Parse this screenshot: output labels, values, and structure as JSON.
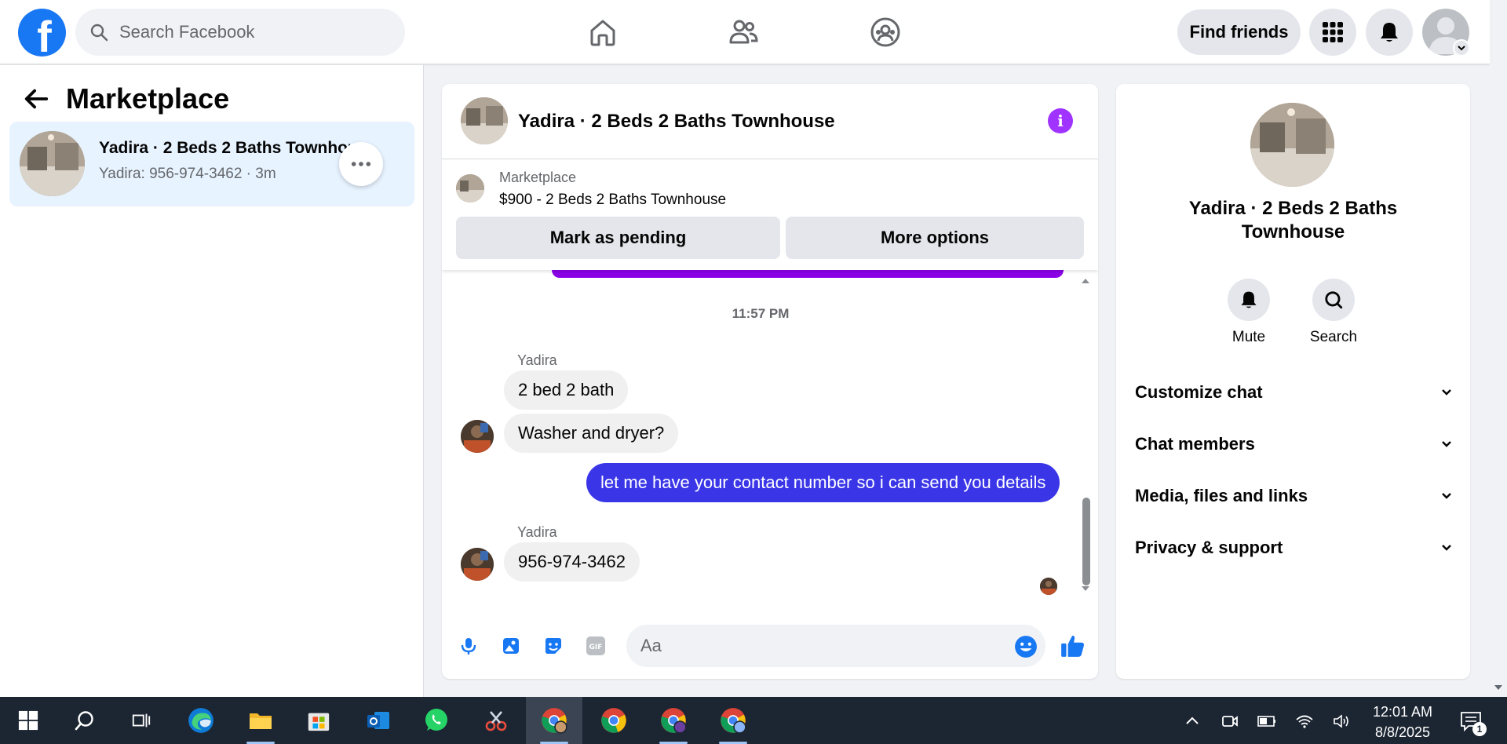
{
  "topbar": {
    "logo_letter": "f",
    "search_placeholder": "Search Facebook",
    "find_friends_label": "Find friends"
  },
  "left_panel": {
    "title": "Marketplace",
    "conversation": {
      "name": "Yadira · 2 Beds 2 Baths Townhouse",
      "preview": "Yadira: 956-974-3462 · 3m"
    }
  },
  "chat": {
    "title": "Yadira · 2 Beds 2 Baths Townhouse",
    "info_icon": "i",
    "listing": {
      "source": "Marketplace",
      "title": "$900 - 2 Beds 2 Baths Townhouse",
      "mark_pending_label": "Mark as pending",
      "more_options_label": "More options"
    },
    "timestamp": "11:57 PM",
    "messages": [
      {
        "sender": "Yadira",
        "text": "2 bed 2 bath"
      },
      {
        "text": "Washer and dryer?"
      },
      {
        "text": "let me have your contact number so i can send you details"
      },
      {
        "sender": "Yadira",
        "text": "956-974-3462"
      }
    ],
    "input_placeholder": "Aa"
  },
  "right_panel": {
    "name": "Yadira · 2 Beds 2 Baths Townhouse",
    "mute_label": "Mute",
    "search_label": "Search",
    "sections": [
      "Customize chat",
      "Chat members",
      "Media, files and links",
      "Privacy & support"
    ]
  },
  "taskbar": {
    "time": "12:01 AM",
    "date": "8/8/2025",
    "notification_count": "1"
  },
  "colors": {
    "facebook_blue": "#1877f2",
    "outgoing_bubble": "#3a36e8",
    "info_purple": "#a033ff",
    "taskbar_bg": "#1c2633"
  }
}
